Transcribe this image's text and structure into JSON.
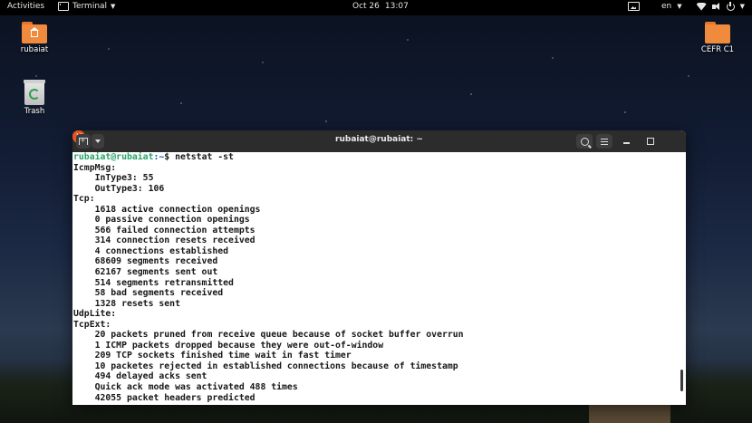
{
  "topbar": {
    "activities": "Activities",
    "app_name": "Terminal",
    "date": "Oct 26",
    "time": "13:07",
    "language": "en"
  },
  "desktop": {
    "icons": [
      {
        "label": "rubaiat",
        "icon": "home-folder-icon"
      },
      {
        "label": "Trash",
        "icon": "trash-icon"
      },
      {
        "label": "CEFR C1",
        "icon": "folder-icon"
      }
    ]
  },
  "window": {
    "title": "rubaiat@rubaiat: ~"
  },
  "terminal": {
    "prompt_user": "rubaiat@rubaiat",
    "prompt_path": ":~",
    "prompt_symbol": "$ ",
    "command": "netstat -st",
    "output": [
      "IcmpMsg:",
      "    InType3: 55",
      "    OutType3: 106",
      "Tcp:",
      "    1618 active connection openings",
      "    0 passive connection openings",
      "    566 failed connection attempts",
      "    314 connection resets received",
      "    4 connections established",
      "    68609 segments received",
      "    62167 segments sent out",
      "    514 segments retransmitted",
      "    58 bad segments received",
      "    1328 resets sent",
      "UdpLite:",
      "TcpExt:",
      "    20 packets pruned from receive queue because of socket buffer overrun",
      "    1 ICMP packets dropped because they were out-of-window",
      "    209 TCP sockets finished time wait in fast timer",
      "    10 packetes rejected in established connections because of timestamp",
      "    494 delayed acks sent",
      "    Quick ack mode was activated 488 times",
      "    42055 packet headers predicted"
    ]
  },
  "colors": {
    "prompt_user": "#26a269",
    "prompt_path": "#1c4bb3",
    "close_button": "#e95420",
    "folder": "#f08a3c",
    "titlebar": "#2c2c2c"
  }
}
